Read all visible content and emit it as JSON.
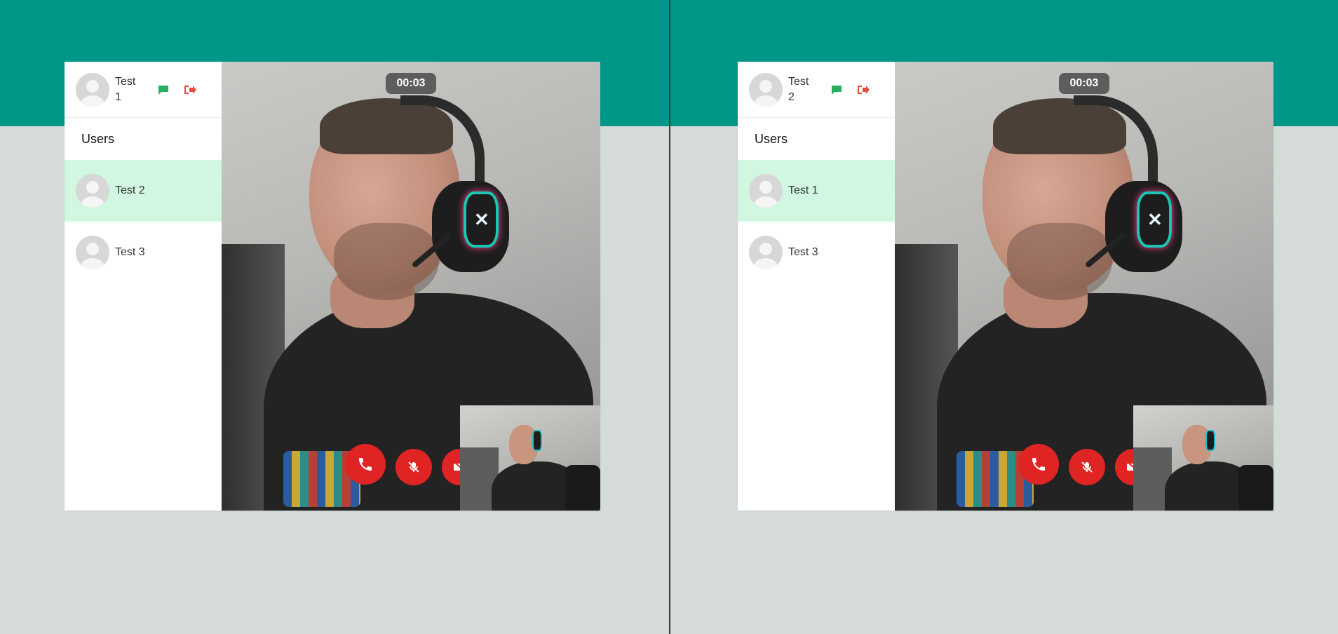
{
  "panes": [
    {
      "current_user": {
        "name": "Test 1"
      },
      "users_heading": "Users",
      "users": [
        {
          "name": "Test 2",
          "active": true
        },
        {
          "name": "Test 3",
          "active": false
        }
      ],
      "call": {
        "timer": "00:03"
      }
    },
    {
      "current_user": {
        "name": "Test 2"
      },
      "users_heading": "Users",
      "users": [
        {
          "name": "Test 1",
          "active": true
        },
        {
          "name": "Test 3",
          "active": false
        }
      ],
      "call": {
        "timer": "00:03"
      }
    }
  ],
  "icons": {
    "chat": "chat-icon",
    "logout": "logout-icon",
    "hangup": "phone-icon",
    "mute": "mic-off-icon",
    "camera": "video-off-icon"
  },
  "colors": {
    "banner": "#009688",
    "active_user": "#d1f7e1",
    "control": "#e02424",
    "chat_icon": "#27ae60",
    "logout_icon": "#e74c3c"
  }
}
